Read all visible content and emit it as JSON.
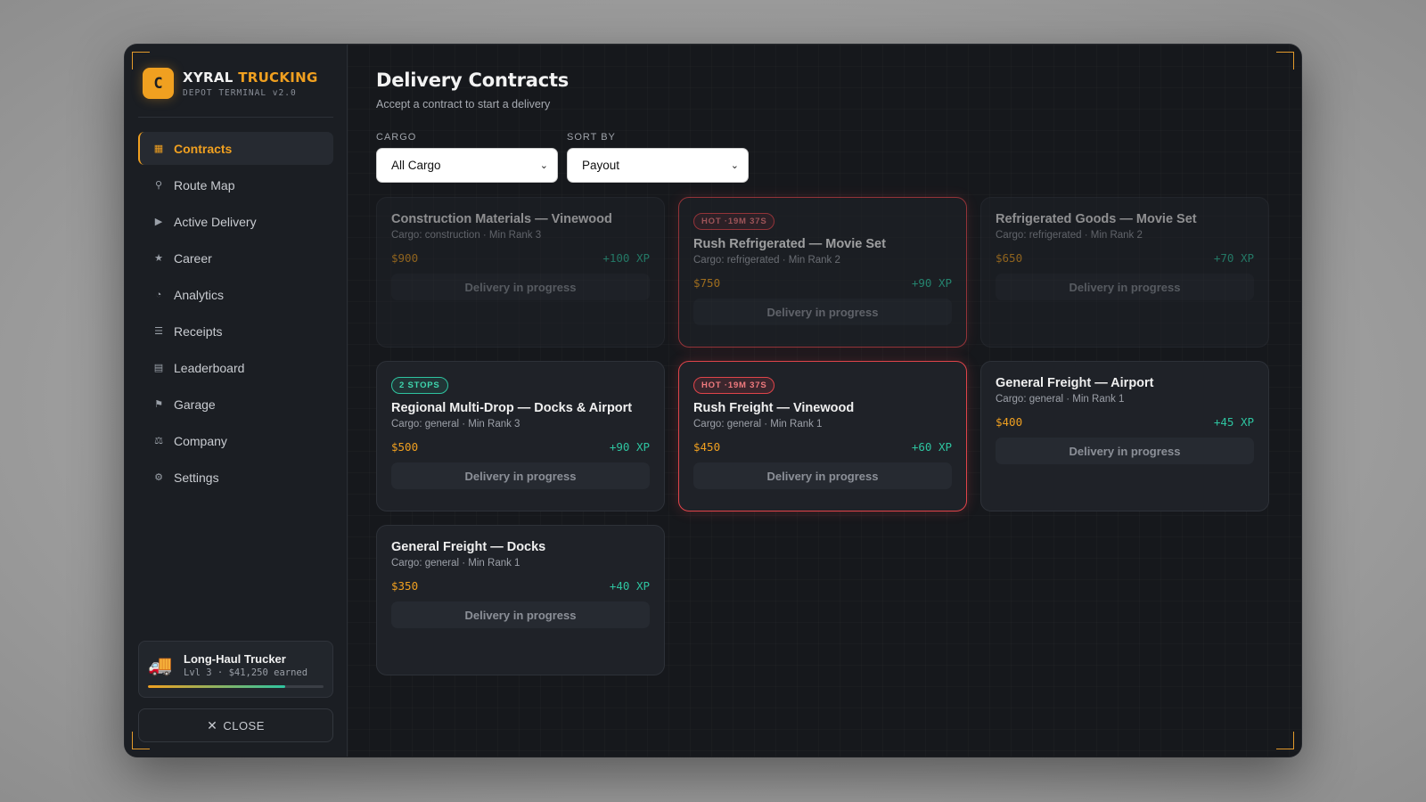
{
  "brand": {
    "logo_letter": "C",
    "name_part1": "XYRAL",
    "name_part2": "TRUCKING",
    "subtitle": "DEPOT TERMINAL v2.0",
    "accent_color": "#f0a020"
  },
  "nav": {
    "items": [
      {
        "label": "Contracts",
        "icon": "contracts-icon",
        "glyph": "▦",
        "active": true
      },
      {
        "label": "Route Map",
        "icon": "map-pin-icon",
        "glyph": "⚲",
        "active": false
      },
      {
        "label": "Active Delivery",
        "icon": "play-icon",
        "glyph": "▶",
        "active": false
      },
      {
        "label": "Career",
        "icon": "star-icon",
        "glyph": "★",
        "active": false
      },
      {
        "label": "Analytics",
        "icon": "gauge-icon",
        "glyph": "◔",
        "active": false
      },
      {
        "label": "Receipts",
        "icon": "receipt-icon",
        "glyph": "☰",
        "active": false
      },
      {
        "label": "Leaderboard",
        "icon": "leaderboard-icon",
        "glyph": "▤",
        "active": false
      },
      {
        "label": "Garage",
        "icon": "flag-icon",
        "glyph": "⚑",
        "active": false
      },
      {
        "label": "Company",
        "icon": "company-icon",
        "glyph": "⚖",
        "active": false
      },
      {
        "label": "Settings",
        "icon": "gear-icon",
        "glyph": "⚙",
        "active": false
      }
    ]
  },
  "profile": {
    "name": "Long-Haul Trucker",
    "stats": "Lvl 3 · $41,250 earned",
    "progress": 0.78,
    "icon": "truck-icon"
  },
  "close_button": {
    "label": "CLOSE",
    "icon": "close-icon"
  },
  "header": {
    "title": "Delivery Contracts",
    "subtitle": "Accept a contract to start a delivery"
  },
  "filters": {
    "cargo": {
      "label": "CARGO",
      "value": "All Cargo"
    },
    "sort": {
      "label": "SORT BY",
      "value": "Payout"
    }
  },
  "contracts": [
    {
      "title": "Construction Materials — Vinewood",
      "meta": "Cargo: construction · Min Rank 3",
      "payout": "$900",
      "xp": "+100 XP",
      "action": "Delivery in progress",
      "badge": "",
      "variant": "dim"
    },
    {
      "title": "Rush Refrigerated — Movie Set",
      "meta": "Cargo: refrigerated · Min Rank 2",
      "payout": "$750",
      "xp": "+90 XP",
      "action": "Delivery in progress",
      "badge": "HOT ·19M 37S",
      "variant": "hot-dim"
    },
    {
      "title": "Refrigerated Goods — Movie Set",
      "meta": "Cargo: refrigerated · Min Rank 2",
      "payout": "$650",
      "xp": "+70 XP",
      "action": "Delivery in progress",
      "badge": "",
      "variant": "dim"
    },
    {
      "title": "Regional Multi-Drop — Docks & Airport",
      "meta": "Cargo: general · Min Rank 3",
      "payout": "$500",
      "xp": "+90 XP",
      "action": "Delivery in progress",
      "badge": "2 STOPS",
      "variant": "stops"
    },
    {
      "title": "Rush Freight — Vinewood",
      "meta": "Cargo: general · Min Rank 1",
      "payout": "$450",
      "xp": "+60 XP",
      "action": "Delivery in progress",
      "badge": "HOT ·19M 37S",
      "variant": "hot"
    },
    {
      "title": "General Freight — Airport",
      "meta": "Cargo: general · Min Rank 1",
      "payout": "$400",
      "xp": "+45 XP",
      "action": "Delivery in progress",
      "badge": "",
      "variant": "normal"
    },
    {
      "title": "General Freight — Docks",
      "meta": "Cargo: general · Min Rank 1",
      "payout": "$350",
      "xp": "+40 XP",
      "action": "Delivery in progress",
      "badge": "",
      "variant": "normal"
    }
  ]
}
